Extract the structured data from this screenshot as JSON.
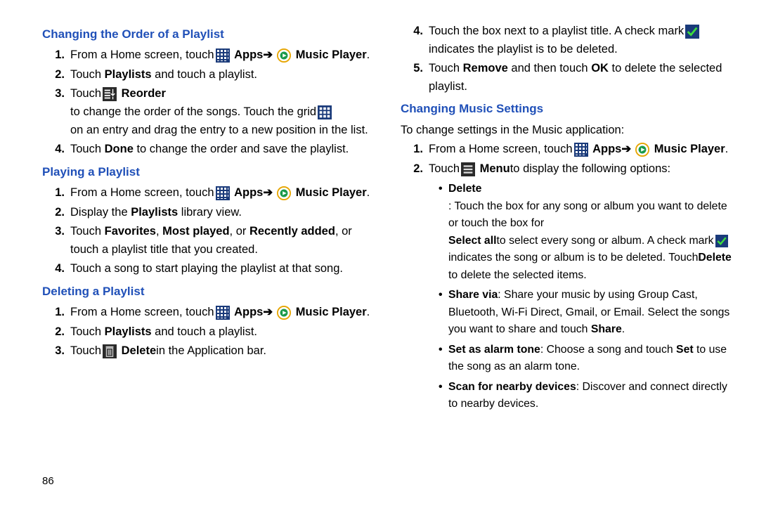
{
  "page_number": "86",
  "col1": {
    "h1": "Changing the Order of a Playlist",
    "s1_1a": "From a Home screen, touch ",
    "s1_1_apps": "Apps",
    "s1_1_mp": "Music Player",
    "s1_2a": "Touch ",
    "s1_2b": "Playlists",
    "s1_2c": " and touch a playlist.",
    "s1_3a": "Touch ",
    "s1_3b": "Reorder",
    "s1_3c": " to change the order of the songs. Touch the grid ",
    "s1_3d": " on an entry and drag the entry to a new position in the list.",
    "s1_4a": "Touch ",
    "s1_4b": "Done",
    "s1_4c": " to change the order and save the playlist.",
    "h2": "Playing a Playlist",
    "s2_1a": "From a Home screen, touch ",
    "s2_2a": "Display the ",
    "s2_2b": "Playlists",
    "s2_2c": " library view.",
    "s2_3a": "Touch ",
    "s2_3b": "Favorites",
    "s2_3c": ", ",
    "s2_3d": "Most played",
    "s2_3e": ", or ",
    "s2_3f": "Recently added",
    "s2_3g": ", or touch a playlist title that you created.",
    "s2_4": "Touch a song to start playing the playlist at that song.",
    "h3": "Deleting a Playlist",
    "s3_1a": "From a Home screen, touch ",
    "s3_2a": "Touch ",
    "s3_2b": "Playlists",
    "s3_2c": " and touch a playlist.",
    "s3_3a": "Touch ",
    "s3_3b": "Delete",
    "s3_3c": " in the Application bar."
  },
  "col2": {
    "s4a": "Touch the box next to a playlist title. A check mark ",
    "s4b": " indicates the playlist is to be deleted.",
    "s5a": "Touch ",
    "s5b": "Remove",
    "s5c": " and then touch ",
    "s5d": "OK",
    "s5e": " to delete the selected playlist.",
    "h4": "Changing Music Settings",
    "intro": "To change settings in the Music application:",
    "m1a": "From a Home screen, touch ",
    "m1_apps": "Apps",
    "m1_mp": "Music Player",
    "m2a": "Touch ",
    "m2b": "Menu",
    "m2c": " to display the following options:",
    "b1a": "Delete",
    "b1b": ": Touch the box for any song or album you want to delete or touch the box for ",
    "b1c": "Select all",
    "b1d": " to select every song or album. A check mark ",
    "b1e": " indicates the song or album is to be deleted. Touch ",
    "b1f": "Delete",
    "b1g": " to delete the selected items.",
    "b2a": "Share via",
    "b2b": ": Share your music by using Group Cast, Bluetooth, Wi-Fi Direct, Gmail, or Email. Select the songs you want to share and touch ",
    "b2c": "Share",
    "b3a": "Set as alarm tone",
    "b3b": ": Choose a song and touch ",
    "b3c": "Set",
    "b3d": " to use the song as an alarm tone.",
    "b4a": "Scan for nearby devices",
    "b4b": ": Discover and connect directly to nearby devices."
  },
  "arrow": "➔",
  "dot": "."
}
